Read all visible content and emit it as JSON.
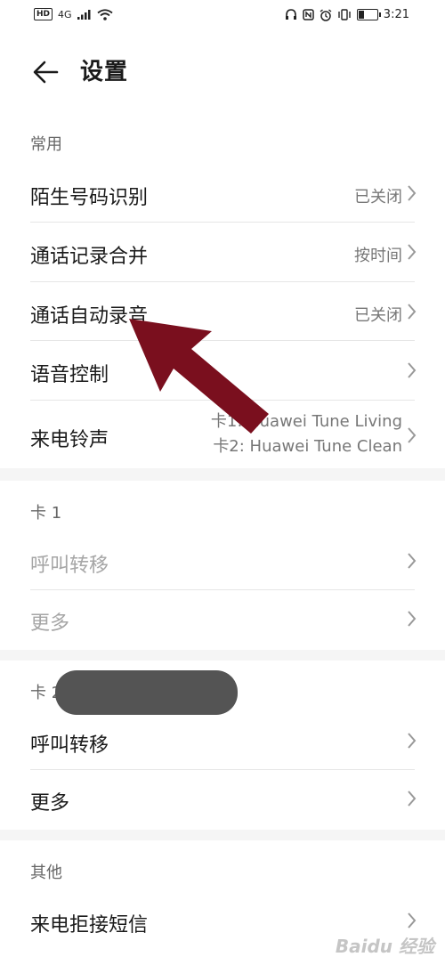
{
  "status": {
    "signal": "4G",
    "time": "3:21"
  },
  "header": {
    "title": "设置"
  },
  "sections": {
    "common": {
      "title": "常用",
      "rows": [
        {
          "label": "陌生号码识别",
          "value": "已关闭"
        },
        {
          "label": "通话记录合并",
          "value": "按时间"
        },
        {
          "label": "通话自动录音",
          "value": "已关闭"
        },
        {
          "label": "语音控制",
          "value": ""
        },
        {
          "label": "来电铃声",
          "value_line1": "卡1: Huawei Tune Living",
          "value_line2": "卡2: Huawei Tune Clean"
        }
      ]
    },
    "card1": {
      "title": "卡 1",
      "rows": [
        {
          "label": "呼叫转移"
        },
        {
          "label": "更多"
        }
      ]
    },
    "card2": {
      "title": "卡 2",
      "rows": [
        {
          "label": "呼叫转移"
        },
        {
          "label": "更多"
        }
      ]
    },
    "other": {
      "title": "其他",
      "rows": [
        {
          "label": "来电拒接短信"
        }
      ]
    }
  },
  "annotation": {
    "arrow_color": "#7a0f1e",
    "redaction_color": "#545454"
  },
  "watermark": "Baidu 经验"
}
